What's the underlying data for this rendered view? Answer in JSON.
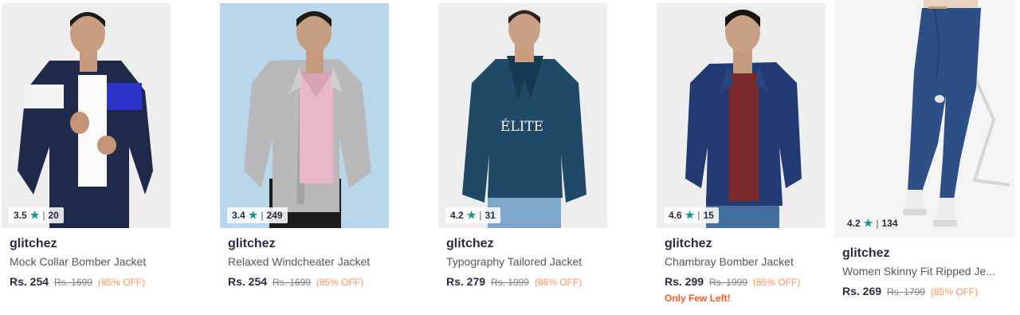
{
  "products": [
    {
      "rating": "3.5",
      "rating_count": "20",
      "brand": "glitchez",
      "name": "Mock Collar Bomber Jacket",
      "price": "Rs. 254",
      "mrp": "Rs. 1699",
      "discount": "(85% OFF)",
      "stock_note": ""
    },
    {
      "rating": "3.4",
      "rating_count": "249",
      "brand": "glitchez",
      "name": "Relaxed Windcheater Jacket",
      "price": "Rs. 254",
      "mrp": "Rs. 1699",
      "discount": "(85% OFF)",
      "stock_note": ""
    },
    {
      "rating": "4.2",
      "rating_count": "31",
      "brand": "glitchez",
      "name": "Typography Tailored Jacket",
      "price": "Rs. 279",
      "mrp": "Rs. 1999",
      "discount": "(86% OFF)",
      "stock_note": "",
      "print_text": "ÉLITE"
    },
    {
      "rating": "4.6",
      "rating_count": "15",
      "brand": "glitchez",
      "name": "Chambray Bomber Jacket",
      "price": "Rs. 299",
      "mrp": "Rs. 1999",
      "discount": "(85% OFF)",
      "stock_note": "Only Few Left!"
    },
    {
      "rating": "4.2",
      "rating_count": "134",
      "brand": "glitchez",
      "name": "Women Skinny Fit Ripped Je...",
      "price": "Rs. 269",
      "mrp": "Rs. 1799",
      "discount": "(85% OFF)",
      "stock_note": ""
    }
  ],
  "star_icon": "star-icon",
  "colors": {
    "star": "#14958f",
    "discount": "#ff905a",
    "stock_note": "#ff5722"
  }
}
